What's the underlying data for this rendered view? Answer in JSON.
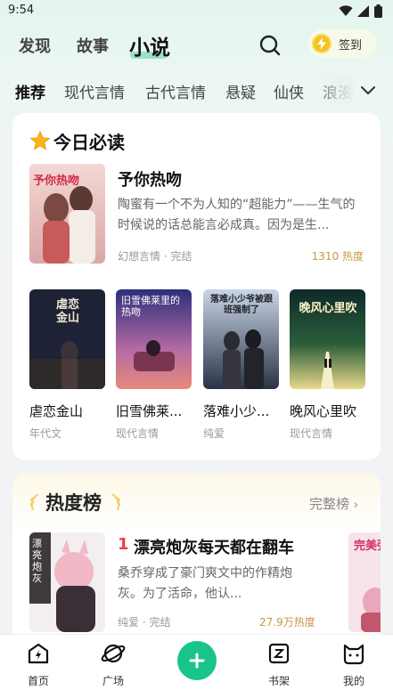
{
  "status_bar": {
    "time": "9:54"
  },
  "top_nav": {
    "tabs": [
      {
        "label": "发现"
      },
      {
        "label": "故事"
      },
      {
        "label": "小说"
      }
    ],
    "signin_label": "签到"
  },
  "categories": [
    "推荐",
    "现代言情",
    "古代言情",
    "悬疑",
    "仙侠",
    "浪漫"
  ],
  "today": {
    "title": "今日必读",
    "featured": {
      "title": "予你热吻",
      "description": "陶蜜有一个不为人知的“超能力”——生气的时候说的话总能言必成真。因为是生...",
      "meta": "幻想言情 · 完结",
      "heat": "1310 热度",
      "cover_text": "予你热吻"
    },
    "books": [
      {
        "title": "虐恋金山",
        "genre": "年代文",
        "cover_text": "虐恋金山"
      },
      {
        "title": "旧雪佛莱...",
        "genre": "现代言情",
        "cover_text": "旧雪佛莱里的热吻"
      },
      {
        "title": "落难小少...",
        "genre": "纯爱",
        "cover_text": "落难小少爷被跟班强制了"
      },
      {
        "title": "晚风心里吹",
        "genre": "现代言情",
        "cover_text": "晚风心里吹"
      }
    ]
  },
  "hot": {
    "title": "热度榜",
    "full_list": "完整榜",
    "item": {
      "rank": "1",
      "title": "漂亮炮灰每天都在翻车",
      "description": "桑乔穿成了豪门爽文中的作精炮灰。为了活命，他认...",
      "meta": "纯爱 · 完结",
      "heat": "27.9万热度",
      "cover_text": "漂亮炮灰"
    },
    "peek_cover_text": "完美强"
  },
  "bottom_tabs": [
    {
      "label": "首页"
    },
    {
      "label": "广场"
    },
    {
      "label": "书架"
    },
    {
      "label": "我的"
    }
  ],
  "colors": {
    "accent": "#18c48a",
    "rank_red": "#e9403f",
    "heat_gold": "#c9964a"
  }
}
